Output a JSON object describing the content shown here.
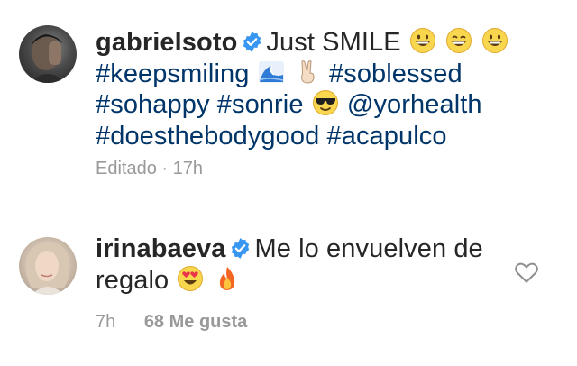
{
  "comments": [
    {
      "username": "gabrielsoto",
      "text": "Just SMILE",
      "hashtags": [
        "#keepsmiling",
        "#soblessed",
        "#sohappy",
        "#sonrie",
        "#doesthebodygood",
        "#acapulco"
      ],
      "mention": "@yorhealth",
      "meta_edited": "Editado",
      "meta_dot": "·",
      "meta_time": "17h",
      "emojis": [
        "grinning-face",
        "grinning-face-smiling-eyes",
        "grinning-face",
        "water-wave",
        "victory-hand",
        "smiling-face-sunglasses"
      ]
    },
    {
      "username": "irinabaeva",
      "text": "Me lo envuelven de regalo",
      "meta_time": "7h",
      "likes": "68 Me gusta",
      "emojis": [
        "heart-eyes-face",
        "fire"
      ]
    }
  ],
  "colors": {
    "text": "#262626",
    "hashtag": "#003569",
    "meta": "#999999",
    "verified": "#3897f0",
    "divider": "#e3e3e3"
  }
}
